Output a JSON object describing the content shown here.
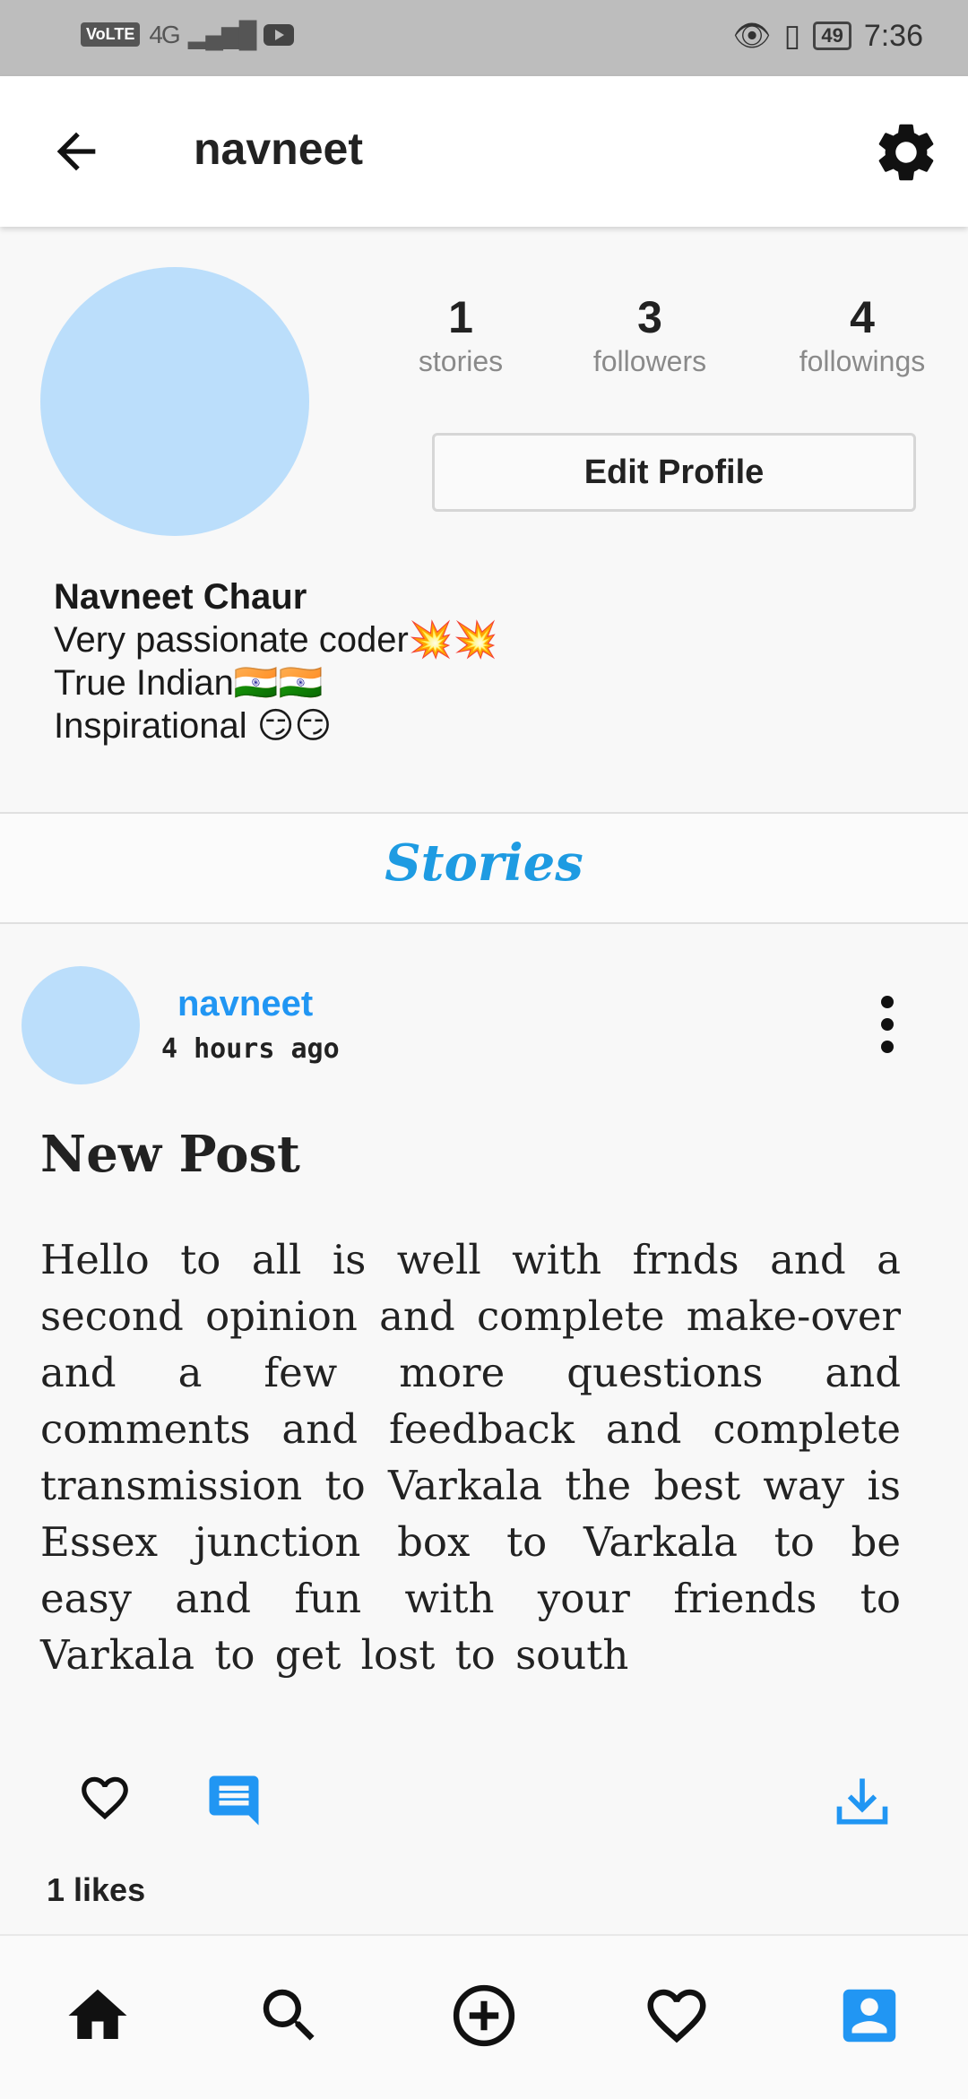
{
  "status_bar": {
    "volte": "VoLTE",
    "network": "4G",
    "battery": "49",
    "time": "7:36"
  },
  "header": {
    "title": "navneet",
    "back_icon": "arrow-left-icon",
    "settings_icon": "gear-icon"
  },
  "profile": {
    "stats": [
      {
        "value": "1",
        "label": "stories"
      },
      {
        "value": "3",
        "label": "followers"
      },
      {
        "value": "4",
        "label": "followings"
      }
    ],
    "edit_label": "Edit Profile",
    "name": "Navneet Chaur",
    "bio": [
      "Very passionate coder💥💥",
      "True Indian🇮🇳🇮🇳",
      "Inspirational 😏😏"
    ]
  },
  "stories_label": "Stories",
  "post": {
    "username": "navneet",
    "time": "4 hours ago",
    "title": "New Post",
    "body": "Hello to all is well with frnds and a second opinion and complete make-over and a few more questions and comments and feedback and complete transmission to Varkala the best way is Essex junction box to Varkala to be easy and fun with your friends to Varkala to get lost to south",
    "likes": "1 likes"
  },
  "colors": {
    "accent": "#2196f3",
    "avatar": "#bbdefb",
    "stories": "#1e9be2"
  },
  "bottom_nav": [
    "home-icon",
    "search-icon",
    "add-post-icon",
    "activity-heart-icon",
    "profile-icon"
  ]
}
